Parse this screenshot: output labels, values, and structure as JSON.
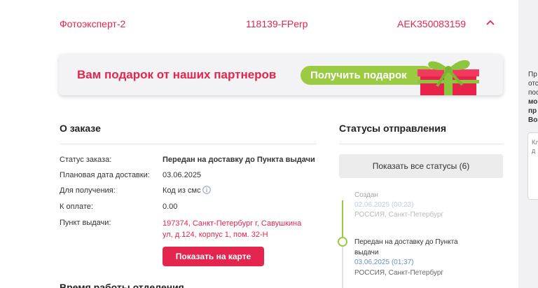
{
  "order_header": {
    "service": "Фотоэксперт-2",
    "order_number": "118139-FPerp",
    "tracking_number": "AEK350083159"
  },
  "banner": {
    "text": "Вам подарок от наших партнеров",
    "button_label": "Получить подарок"
  },
  "about_order": {
    "title": "О заказе",
    "rows": [
      {
        "label": "Статус заказа:",
        "value": "Передан на доставку до Пункта выдачи"
      },
      {
        "label": "Плановая дата доставки:",
        "value": "03.06.2025"
      },
      {
        "label": "Для получения:",
        "value": "Код из смс"
      },
      {
        "label": "К оплате:",
        "value": "0.00"
      },
      {
        "label": "Пункт выдачи:",
        "value": "197374, Санкт-Петербург г, Савушкина ул, д.124, корпус 1, пом. 32-Н"
      }
    ],
    "map_button": "Показать на карте",
    "work_hours_title": "Время работы отделения"
  },
  "statuses": {
    "title": "Статусы отправления",
    "show_all_button": "Показать все статусы (6)",
    "items": [
      {
        "title": "Создан",
        "datetime": "02.06.2025 (00:23)",
        "location": "РОССИЯ, Санкт-Петербург"
      },
      {
        "title": "Передан на доставку до Пункта выдачи",
        "datetime": "03.06.2025 (01:37)",
        "location": "РОССИЯ, Санкт-Петербург"
      }
    ]
  },
  "sidebar": {
    "lines": [
      "Пр",
      "отс",
      "пос",
      "мо",
      "пр",
      "Воз"
    ],
    "box_lines": [
      "Кл",
      "д"
    ]
  },
  "colors": {
    "accent": "#e4264e",
    "green": "#9bcb43"
  },
  "icons": {
    "chevron": "chevron-up-icon",
    "info": "info-icon",
    "gift": "gift-box-icon"
  }
}
